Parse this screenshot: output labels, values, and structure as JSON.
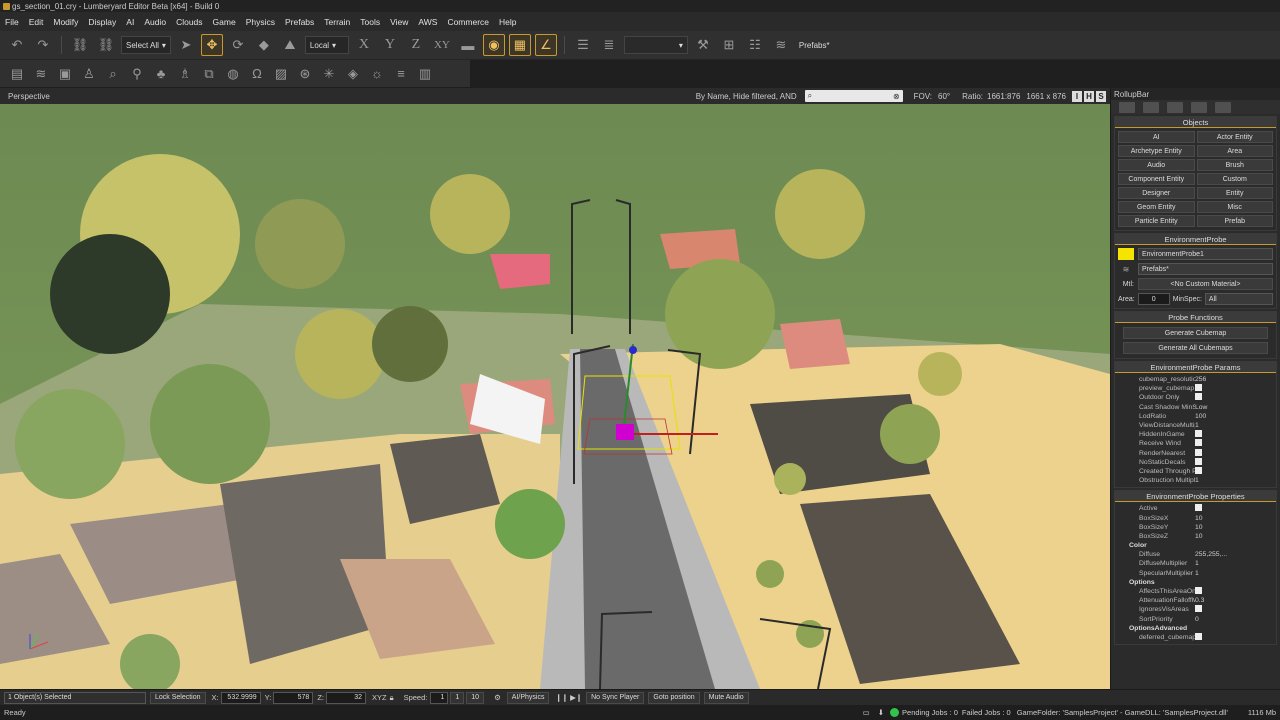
{
  "window": {
    "title": "gs_section_01.cry - Lumberyard Editor Beta [x64] - Build 0"
  },
  "menu": [
    "File",
    "Edit",
    "Modify",
    "Display",
    "AI",
    "Audio",
    "Clouds",
    "Game",
    "Physics",
    "Prefabs",
    "Terrain",
    "Tools",
    "View",
    "AWS",
    "Commerce",
    "Help"
  ],
  "toolbar": {
    "select_all": "Select All",
    "coord_space": "Local",
    "axis_x": "X",
    "axis_y": "Y",
    "axis_z": "Z",
    "axis_xy": "XY",
    "prefabs_label": "Prefabs*"
  },
  "viewport": {
    "name": "Perspective",
    "filter": "By Name, Hide filtered, AND",
    "fov_label": "FOV:",
    "fov_value": "60°",
    "ratio_label": "Ratio:",
    "ratio_value": "1661:876",
    "resolution": "1661 x 876",
    "btn_i": "I",
    "btn_h": "H",
    "btn_s": "S"
  },
  "rollup": {
    "title": "RollupBar",
    "objects_header": "Objects",
    "object_buttons": [
      "AI",
      "Actor Entity",
      "Archetype Entity",
      "Area",
      "Audio",
      "Brush",
      "Component Entity",
      "Custom",
      "Designer",
      "Entity",
      "Geom Entity",
      "Misc",
      "Particle Entity",
      "Prefab"
    ],
    "probe_header": "EnvironmentProbe",
    "probe_name": "EnvironmentProbe1",
    "probe_layer": "Prefabs*",
    "mtl_label": "Mtl:",
    "mtl_value": "<No Custom Material>",
    "area_label": "Area:",
    "area_value": "0",
    "minspec_label": "MinSpec:",
    "minspec_value": "All",
    "functions_header": "Probe Functions",
    "generate_cubemap": "Generate Cubemap",
    "generate_all": "Generate All Cubemaps",
    "params_header": "EnvironmentProbe Params",
    "params": [
      {
        "k": "cubemap_resolution",
        "v": "256"
      },
      {
        "k": "preview_cubemap",
        "v": ""
      },
      {
        "k": "Outdoor Only",
        "v": ""
      },
      {
        "k": "Cast Shadow MinSpec",
        "v": "Low"
      },
      {
        "k": "LodRatio",
        "v": "100"
      },
      {
        "k": "ViewDistanceMultiplier",
        "v": "1"
      },
      {
        "k": "HiddenInGame",
        "v": ""
      },
      {
        "k": "Receive Wind",
        "v": ""
      },
      {
        "k": "RenderNearest",
        "v": ""
      },
      {
        "k": "NoStaticDecals",
        "v": ""
      },
      {
        "k": "Created Through Pool",
        "v": ""
      },
      {
        "k": "Obstruction Multiplier",
        "v": "1"
      }
    ],
    "props_header": "EnvironmentProbe Properties",
    "props": [
      {
        "k": "Active",
        "v": ""
      },
      {
        "k": "BoxSizeX",
        "v": "10"
      },
      {
        "k": "BoxSizeY",
        "v": "10"
      },
      {
        "k": "BoxSizeZ",
        "v": "10"
      },
      {
        "k": "Color",
        "v": "",
        "group": true
      },
      {
        "k": "Diffuse",
        "v": "255,255,..."
      },
      {
        "k": "DiffuseMultiplier",
        "v": "1"
      },
      {
        "k": "SpecularMultiplier",
        "v": "1"
      },
      {
        "k": "Options",
        "v": "",
        "group": true
      },
      {
        "k": "AffectsThisAreaOnly",
        "v": ""
      },
      {
        "k": "AttenuationFalloffMax",
        "v": "0.3"
      },
      {
        "k": "IgnoresVisAreas",
        "v": ""
      },
      {
        "k": "SortPriority",
        "v": "0"
      },
      {
        "k": "OptionsAdvanced",
        "v": "",
        "group": true
      },
      {
        "k": "deferred_cubemap",
        "v": ""
      }
    ]
  },
  "statusbar": {
    "selected": "1 Object(s) Selected",
    "lock": "Lock Selection",
    "x_label": "X:",
    "x": "532.9999",
    "y_label": "Y:",
    "y": "578",
    "z_label": "Z:",
    "z": "32",
    "xyz": "XYZ",
    "speed_label": "Speed:",
    "speed": "1",
    "speed_opts": [
      "1",
      "1",
      "10"
    ],
    "ai_physics": "AI/Physics",
    "no_sync": "No Sync Player",
    "goto": "Goto position",
    "mute": "Mute Audio"
  },
  "bottom": {
    "ready": "Ready",
    "pending": "Pending Jobs : 0",
    "failed": "Failed Jobs : 0",
    "gamefolder": "GameFolder: 'SamplesProject' - GameDLL: 'SamplesProject.dll'",
    "memory": "1116 Mb"
  },
  "colors": {
    "accent": "#c69a2f",
    "probe_swatch": "#f5e400",
    "ground": "#ecd28c",
    "grass": "#6f8a4a"
  }
}
